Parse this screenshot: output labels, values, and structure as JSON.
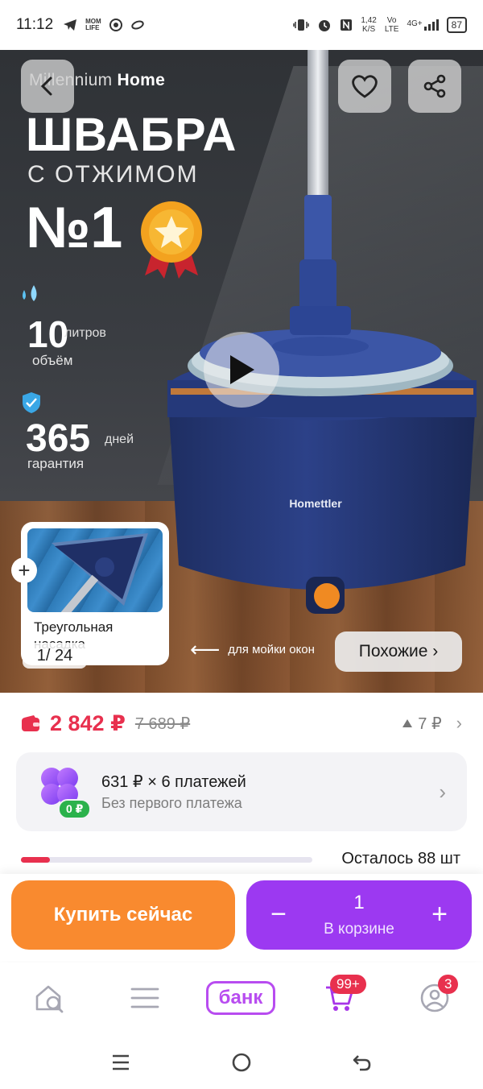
{
  "status_bar": {
    "time": "11:12",
    "left_icons": [
      "telegram-icon",
      "mts-life-icon",
      "chrome-icon",
      "circle-icon"
    ],
    "net_speed_value": "1,42",
    "net_speed_unit": "K/S",
    "vo_lte": [
      "Vo",
      "LTE"
    ],
    "network": "4G+",
    "battery": "87",
    "right_icons": [
      "vibrate-icon",
      "alarm-icon",
      "nfc-icon",
      "signal-icon",
      "battery-icon"
    ]
  },
  "hero": {
    "brand_light": "Millennium",
    "brand_bold": "Home",
    "title_line1": "ШВАБРА",
    "title_line2": "С ОТЖИМОМ",
    "title_line3": "№1",
    "feature1_number": "10",
    "feature1_unit": "литров",
    "feature1_label": "объём",
    "feature2_number": "365",
    "feature2_unit": "дней",
    "feature2_label": "гарантия",
    "product_logo": "Homettler",
    "inset_title": "Треугольная насадка",
    "counter": "1/ 24",
    "swipe_hint": "для мойки окон",
    "similar_button": "Похожие ›",
    "icons": [
      "back-arrow-icon",
      "heart-icon",
      "share-icon",
      "play-icon",
      "plus-icon",
      "drop-icon",
      "shield-check-icon",
      "medal-icon"
    ]
  },
  "price": {
    "current": "2 842 ₽",
    "old": "7 689 ₽",
    "delta": "7 ₽",
    "delta_icon": "triangle-up-icon",
    "accent_color": "#e8304e"
  },
  "installments": {
    "title": "631 ₽ × 6 платежей",
    "subtitle": "Без первого платежа",
    "badge": "0 ₽"
  },
  "stock": {
    "text": "Осталось 88 шт",
    "fraction": 0.1
  },
  "actions": {
    "buy_now": "Купить сейчас",
    "cart_qty": "1",
    "cart_label": "В корзине",
    "minus": "−",
    "plus": "+",
    "buy_color": "#f98a2f",
    "cart_color": "#9c39f1"
  },
  "bottom_nav": {
    "home_icon": "home-search-icon",
    "catalog_icon": "menu-icon",
    "bank_label": "банк",
    "cart_icon": "cart-icon",
    "cart_badge": "99+",
    "profile_icon": "profile-icon",
    "profile_badge": "3"
  },
  "system_nav": [
    "recent-apps-icon",
    "home-circle-icon",
    "back-icon"
  ]
}
